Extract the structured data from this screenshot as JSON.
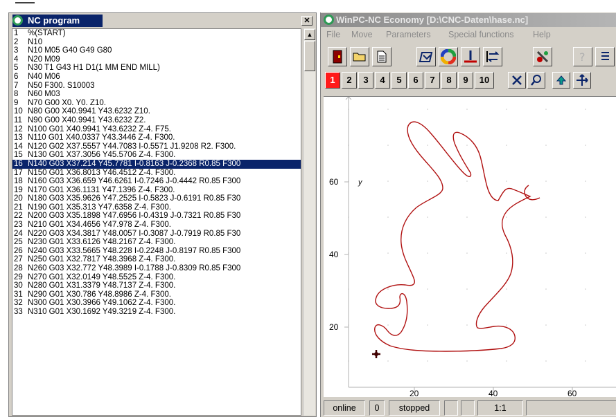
{
  "nc_window": {
    "title": "NC program",
    "close_label": "✕",
    "selected_line": "16",
    "lines": [
      {
        "n": "1",
        "code": "%(START)"
      },
      {
        "n": "2",
        "code": "N10"
      },
      {
        "n": "3",
        "code": "N10 M05 G40 G49 G80"
      },
      {
        "n": "4",
        "code": "N20 M09"
      },
      {
        "n": "5",
        "code": "N30 T1 G43 H1 D1(1 MM END MILL)"
      },
      {
        "n": "6",
        "code": "N40 M06"
      },
      {
        "n": "7",
        "code": "N50 F300. S10003"
      },
      {
        "n": "8",
        "code": "N60 M03"
      },
      {
        "n": "9",
        "code": "N70 G00 X0. Y0. Z10."
      },
      {
        "n": "10",
        "code": "N80 G00 X40.9941 Y43.6232 Z10."
      },
      {
        "n": "11",
        "code": "N90 G00 X40.9941 Y43.6232 Z2."
      },
      {
        "n": "12",
        "code": "N100 G01 X40.9941 Y43.6232 Z-4. F75."
      },
      {
        "n": "13",
        "code": "N110 G01 X40.0337 Y43.3446 Z-4. F300."
      },
      {
        "n": "14",
        "code": "N120 G02 X37.5557 Y44.7083 I-0.5571 J1.9208 R2. F300."
      },
      {
        "n": "15",
        "code": "N130 G01 X37.3056 Y45.5706 Z-4. F300."
      },
      {
        "n": "16",
        "code": "N140 G03 X37.214 Y45.7781 I-0.8163 J-0.2368 R0.85 F300"
      },
      {
        "n": "17",
        "code": "N150 G01 X36.8013 Y46.4512 Z-4. F300."
      },
      {
        "n": "18",
        "code": "N160 G03 X36.659 Y46.6261 I-0.7246 J-0.4442 R0.85 F300"
      },
      {
        "n": "19",
        "code": "N170 G01 X36.1131 Y47.1396 Z-4. F300."
      },
      {
        "n": "20",
        "code": "N180 G03 X35.9626 Y47.2525 I-0.5823 J-0.6191 R0.85 F30"
      },
      {
        "n": "21",
        "code": "N190 G01 X35.313 Y47.6358 Z-4. F300."
      },
      {
        "n": "22",
        "code": "N200 G03 X35.1898 Y47.6956 I-0.4319 J-0.7321 R0.85 F30"
      },
      {
        "n": "23",
        "code": "N210 G01 X34.4656 Y47.978 Z-4. F300."
      },
      {
        "n": "24",
        "code": "N220 G03 X34.3817 Y48.0057 I-0.3087 J-0.7919 R0.85 F30"
      },
      {
        "n": "25",
        "code": "N230 G01 X33.6126 Y48.2167 Z-4. F300."
      },
      {
        "n": "26",
        "code": "N240 G03 X33.5665 Y48.228 I-0.2248 J-0.8197 R0.85 F300"
      },
      {
        "n": "27",
        "code": "N250 G01 X32.7817 Y48.3968 Z-4. F300."
      },
      {
        "n": "28",
        "code": "N260 G03 X32.772 Y48.3989 I-0.1788 J-0.8309 R0.85 F300"
      },
      {
        "n": "29",
        "code": "N270 G01 X32.0149 Y48.5525 Z-4. F300."
      },
      {
        "n": "30",
        "code": "N280 G01 X31.3379 Y48.7137 Z-4. F300."
      },
      {
        "n": "31",
        "code": "N290 G01 X30.786 Y48.8986 Z-4. F300."
      },
      {
        "n": "32",
        "code": "N300 G01 X30.3966 Y49.1062 Z-4. F300."
      },
      {
        "n": "33",
        "code": "N310 G01 X30.1692 Y49.3219 Z-4. F300."
      }
    ]
  },
  "win_window": {
    "title": "WinPC-NC Economy [D:\\CNC-Daten\\hase.nc]",
    "menu": [
      "File",
      "Move",
      "Parameters",
      "Special functions",
      "Help"
    ],
    "toolbar_icons": [
      "exit-door-icon",
      "open-folder-icon",
      "document-icon",
      "toolpath-icon",
      "color-wheel-icon",
      "reference-icon",
      "transfer-icon",
      "manual-move-icon",
      "help-icon",
      "list-icon"
    ],
    "tool_buttons": [
      "1",
      "2",
      "3",
      "4",
      "5",
      "6",
      "7",
      "8",
      "9",
      "10"
    ],
    "active_tool": "1",
    "view_icons": [
      "cancel-x-icon",
      "zoom-icon",
      "up-arrow-icon",
      "move-cross-icon"
    ],
    "plot": {
      "y_axis_label": "y",
      "y_ticks": [
        "60",
        "40",
        "20"
      ],
      "x_ticks": [
        "20",
        "40",
        "60"
      ],
      "path_color": "#b01010",
      "axis_color": "#b0b0b0"
    },
    "status": {
      "mode": "online",
      "count": "0",
      "state": "stopped",
      "scale": "1:1"
    }
  }
}
